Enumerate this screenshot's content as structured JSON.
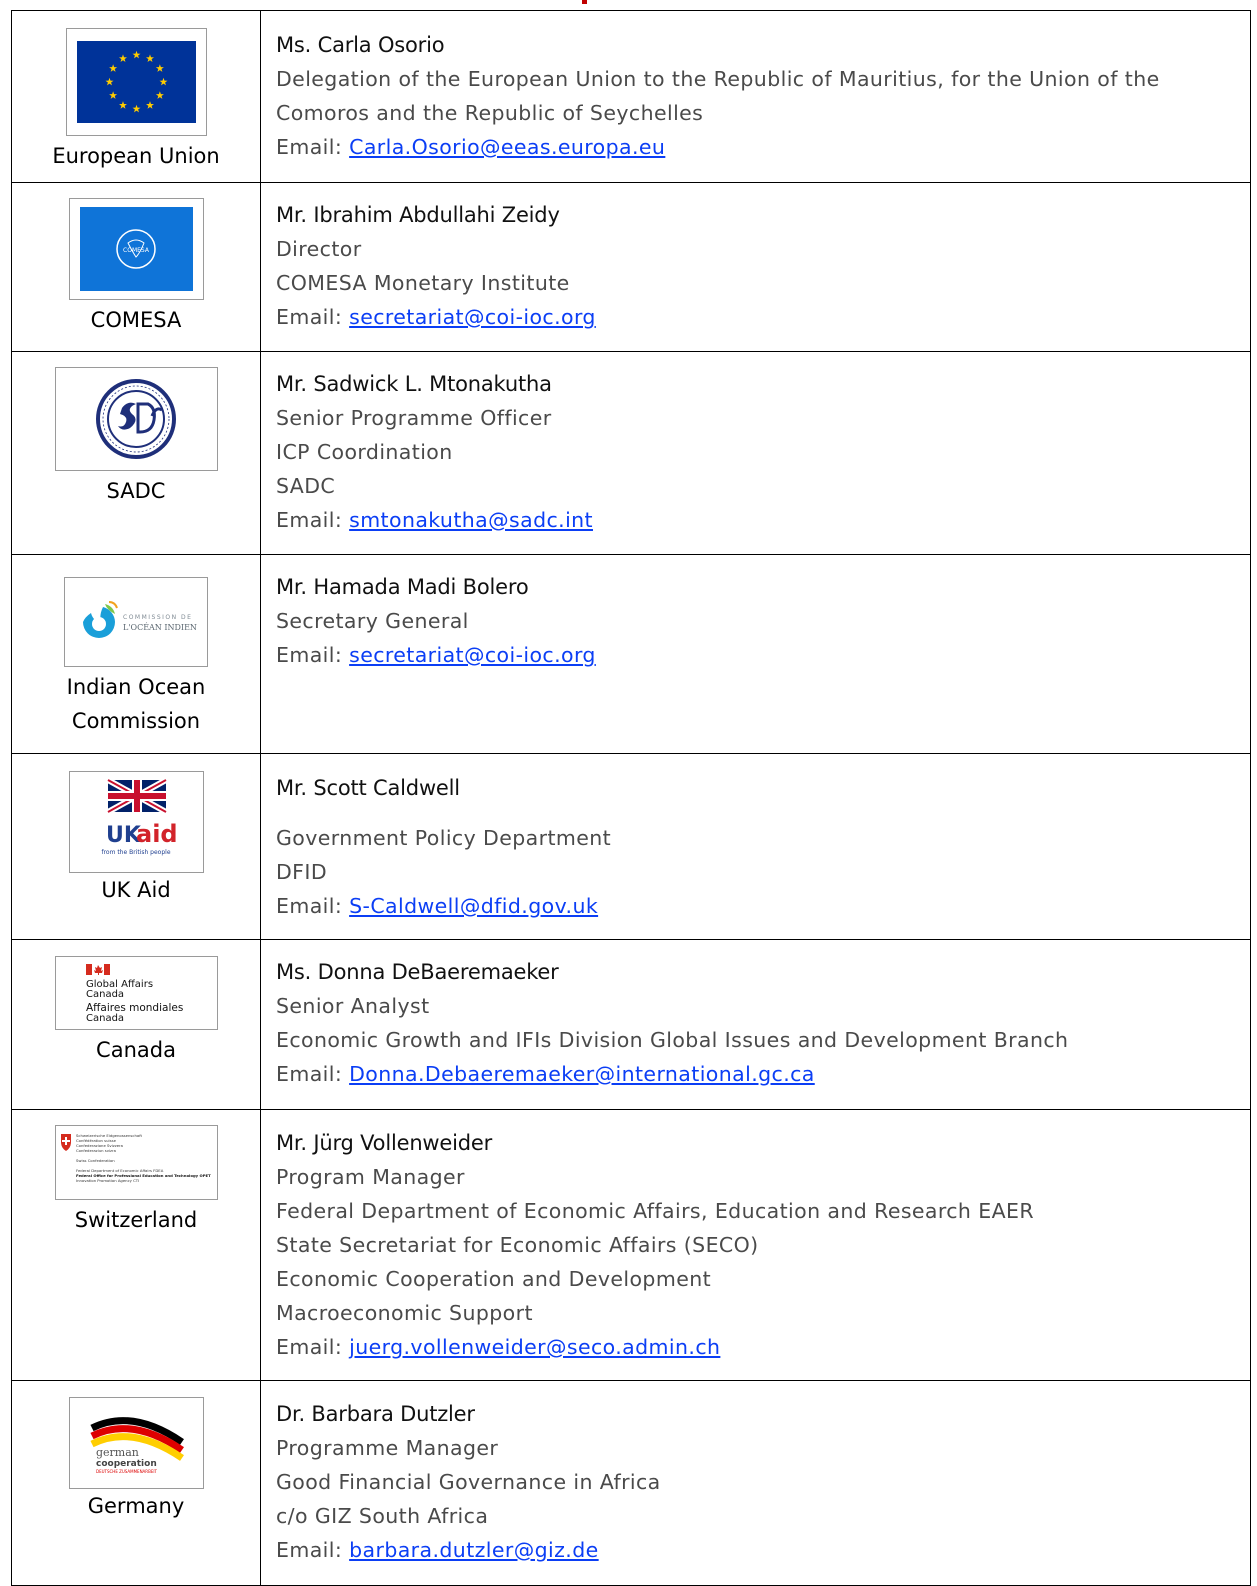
{
  "rows": [
    {
      "org": "European Union",
      "name": "Ms. Carla Osorio",
      "lines": [
        "Delegation of the European Union to the Republic of Mauritius, for the Union of the",
        "Comoros and the Republic of Seychelles"
      ],
      "email_label": "Email: ",
      "email": "Carla.Osorio@eeas.europa.eu",
      "logo": "eu-flag"
    },
    {
      "org": "COMESA",
      "name": "Mr. Ibrahim Abdullahi Zeidy",
      "lines": [
        "Director",
        "COMESA Monetary Institute"
      ],
      "email_label": "Email: ",
      "email": "secretariat@coi-ioc.org",
      "logo": "comesa-logo",
      "logo_text": "COMESA"
    },
    {
      "org": "SADC",
      "name": "Mr. Sadwick L. Mtonakutha",
      "lines": [
        "Senior Programme Officer",
        "ICP Coordination",
        "SADC"
      ],
      "email_label": "Email: ",
      "email": "smtonakutha@sadc.int",
      "logo": "sadc-seal"
    },
    {
      "org_lines": [
        "Indian Ocean",
        "Commission"
      ],
      "name": "Mr. Hamada Madi Bolero",
      "lines": [
        "Secretary General"
      ],
      "email_label": "Email: ",
      "email": "secretariat@coi-ioc.org",
      "logo": "coi-logo",
      "logo_text_1": "COMMISSION DE",
      "logo_text_2": "L'OCÉAN INDIEN"
    },
    {
      "org": "UK Aid",
      "name": "Mr. Scott Caldwell",
      "lines": [
        "Government Policy Department",
        "DFID"
      ],
      "email_label": "Email: ",
      "email": "S-Caldwell@dfid.gov.uk",
      "logo": "ukaid-logo",
      "logo_text_1": "UK",
      "logo_text_2": "aid",
      "logo_text_3": "from the British people"
    },
    {
      "org": "Canada",
      "name": "Ms. Donna DeBaeremaeker",
      "lines": [
        "Senior Analyst",
        "Economic Growth and IFIs Division Global Issues and Development Branch"
      ],
      "email_label": "Email: ",
      "email": "Donna.Debaeremaeker@international.gc.ca",
      "logo": "canada-logo",
      "logo_text_1": "Global Affairs",
      "logo_text_2": "Canada",
      "logo_text_3": "Affaires mondiales",
      "logo_text_4": "Canada"
    },
    {
      "org": "Switzerland",
      "name": "Mr. Jürg Vollenweider",
      "lines": [
        "Program Manager",
        "Federal Department of Economic Affairs, Education and Research EAER",
        "State Secretariat for Economic Affairs (SECO)",
        "Economic Cooperation and Development",
        "Macroeconomic Support"
      ],
      "email_label": "Email: ",
      "email": "juerg.vollenweider@seco.admin.ch",
      "logo": "swiss-confederation-logo",
      "logo_text_1": "Schweizerische Eidgenossenschaft",
      "logo_text_2": "Confédération suisse",
      "logo_text_3": "Confederazione Svizzera",
      "logo_text_4": "Confederaziun svizra",
      "logo_text_5": "Swiss Confederation",
      "logo_text_6": "Federal Department of Economic Affairs FDEA",
      "logo_text_7": "Federal Office for Professional Education and Technology OPET",
      "logo_text_8": "Innovation Promotion Agency CTI"
    },
    {
      "org": "Germany",
      "name": "Dr. Barbara Dutzler",
      "lines": [
        "Programme Manager",
        "Good Financial Governance in Africa",
        "c/o GIZ South Africa"
      ],
      "email_label": "Email: ",
      "email": "barbara.dutzler@giz.de",
      "logo": "german-cooperation-logo",
      "logo_text_1": "german",
      "logo_text_2": "cooperation",
      "logo_text_3": "DEUTSCHE ZUSAMMENARBEIT"
    }
  ],
  "colors": {
    "link": "#0b3ef5",
    "eu_blue": "#003399",
    "eu_gold": "#ffcc00",
    "comesa_blue": "#0f74d8",
    "border": "#000000",
    "top_fragment": "#c00000"
  }
}
